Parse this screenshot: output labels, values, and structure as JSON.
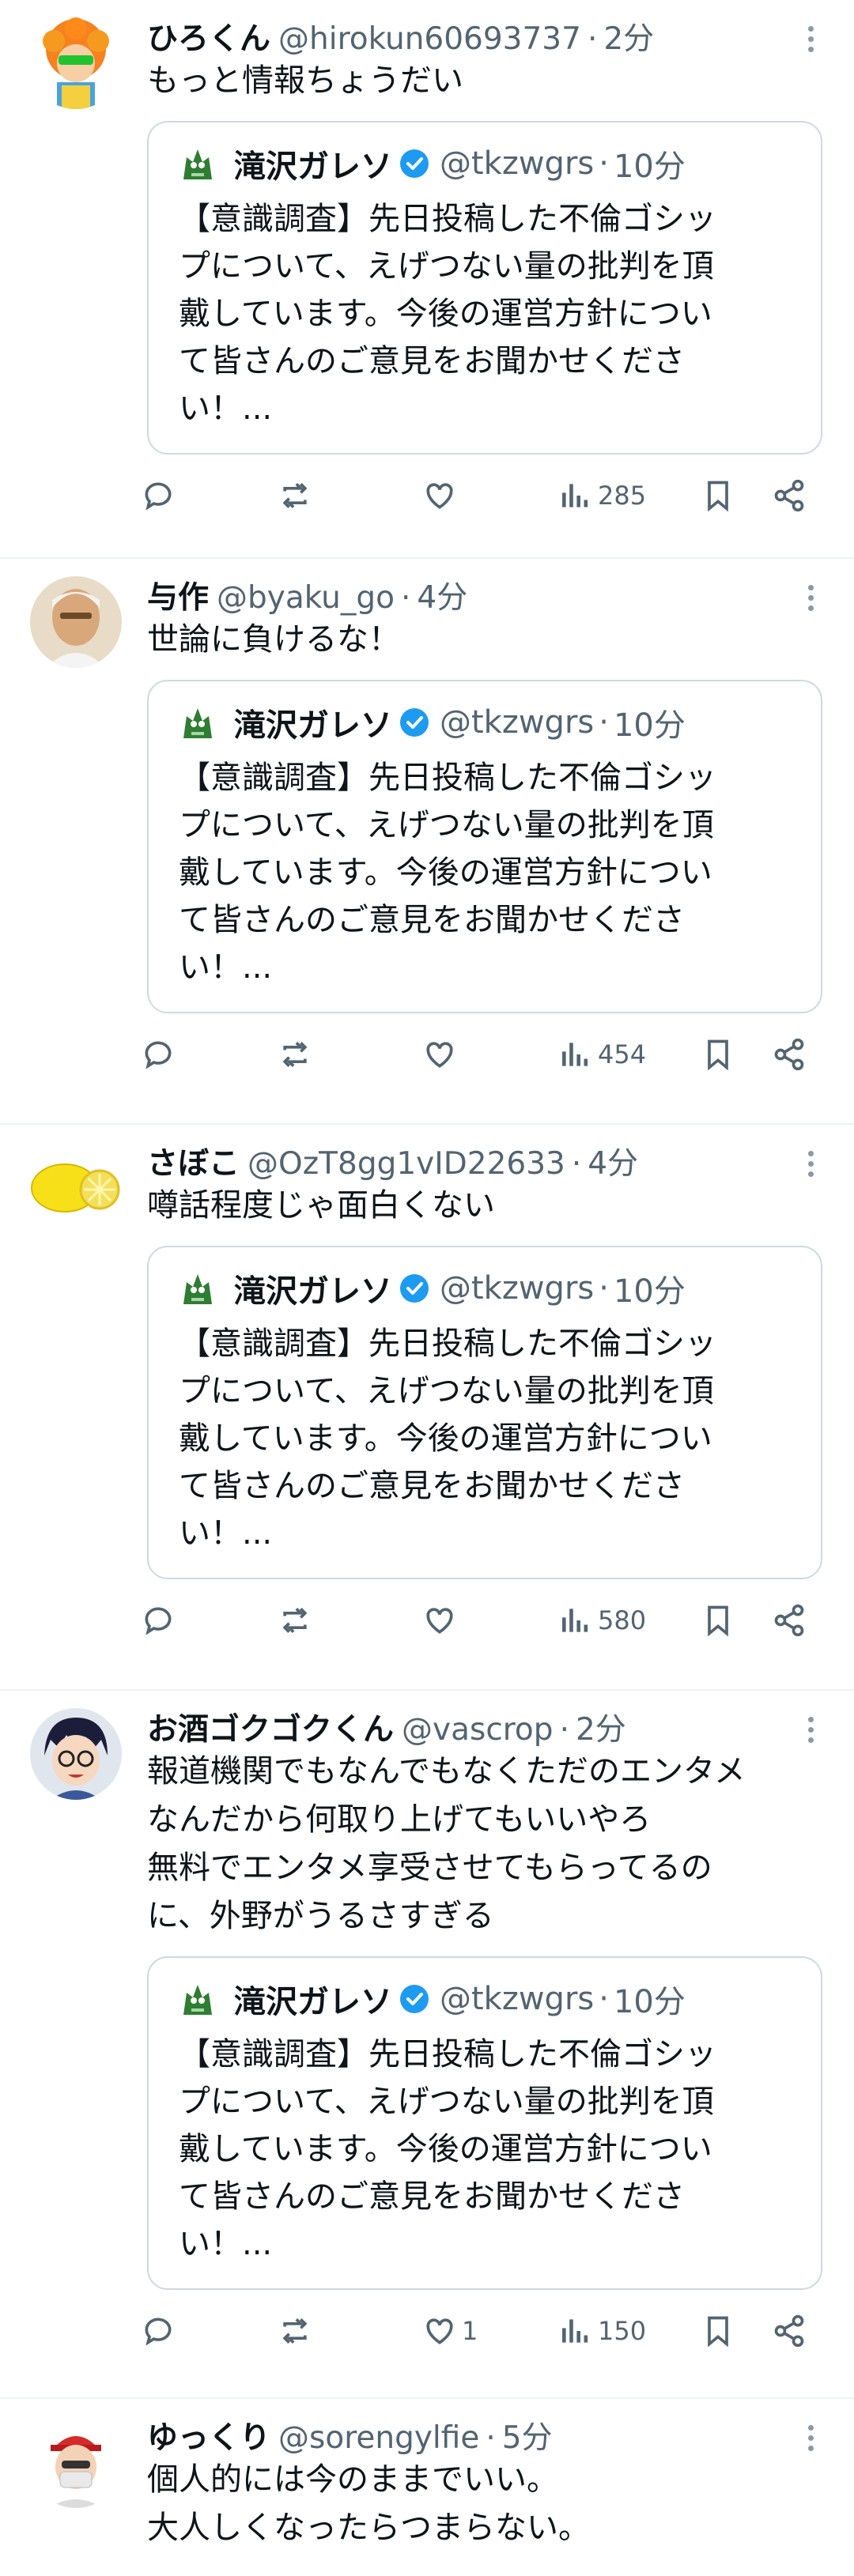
{
  "tweets": [
    {
      "name": "ひろくん",
      "handle": "@hirokun60693737",
      "time": "2分",
      "text": "もっと情報ちょうだい",
      "avatar": "orange-hair-character",
      "likes": "",
      "views": "285"
    },
    {
      "name": "与作",
      "handle": "@byaku_go",
      "time": "4分",
      "text": "世論に負けるな！",
      "avatar": "elderly-man-photo",
      "likes": "",
      "views": "454"
    },
    {
      "name": "さぼこ",
      "handle": "@OzT8gg1vID22633",
      "time": "4分",
      "text": "噂話程度じゃ面白くない",
      "avatar": "lemon",
      "likes": "",
      "views": "580"
    },
    {
      "name": "お酒ゴクゴクくん",
      "handle": "@vascrop",
      "time": "2分",
      "text": "報道機関でもなんでもなくただのエンタメ\nなんだから何取り上げてもいいやろ\n無料でエンタメ享受させてもらってるの\nに、外野がうるさすぎる",
      "avatar": "anime-boy-glasses",
      "likes": "1",
      "views": "150"
    },
    {
      "name": "ゆっくり",
      "handle": "@sorengylfie",
      "time": "5分",
      "text": "個人的には今のままでいい。\n大人しくなったらつまらない。",
      "avatar": "masked-man-red-cap",
      "likes": "",
      "views": ""
    }
  ],
  "quote": {
    "name": "滝沢ガレソ",
    "handle": "@tkzwgrs",
    "time": "10分",
    "text": "【意識調査】先日投稿した不倫ゴシッ\nプについて、えげつない量の批判を頂\n戴しています。今後の運営方針につい\nて皆さんのご意見をお聞かせくださ\nい！...",
    "avatar": "green-dragon-icon"
  },
  "separator": "·",
  "colors": {
    "muted": "#536471",
    "verified": "#1d9bf0",
    "border": "#cfd9de"
  }
}
